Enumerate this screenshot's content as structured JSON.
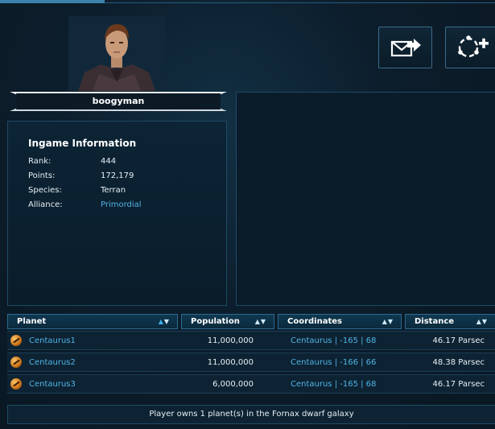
{
  "profile": {
    "player_name": "boogyman",
    "avatar_icon": "commander-portrait"
  },
  "actions": {
    "message_icon": "send-message-icon",
    "friend_icon": "add-buddy-icon"
  },
  "info": {
    "title": "Ingame Information",
    "rows": [
      {
        "label": "Rank:",
        "value": "444"
      },
      {
        "label": "Points:",
        "value": "172,179"
      },
      {
        "label": "Species:",
        "value": "Terran"
      },
      {
        "label": "Alliance:",
        "value": "Primordial"
      }
    ]
  },
  "table": {
    "headers": {
      "planet": "Planet",
      "population": "Population",
      "coordinates": "Coordinates",
      "distance": "Distance"
    },
    "rows": [
      {
        "planet": "Centaurus1",
        "population": "11,000,000",
        "coordinates": "Centaurus | -165 | 68",
        "distance": "46.17 Parsec"
      },
      {
        "planet": "Centaurus2",
        "population": "11,000,000",
        "coordinates": "Centaurus | -166 | 66",
        "distance": "48.38 Parsec"
      },
      {
        "planet": "Centaurus3",
        "population": "6,000,000",
        "coordinates": "Centaurus | -165 | 68",
        "distance": "46.17 Parsec"
      }
    ]
  },
  "footer": {
    "text": "Player owns 1 planet(s) in the Fornax dwarf galaxy"
  },
  "colors": {
    "accent": "#4fb3e6",
    "background": "#0b1a27",
    "border": "#2b6a90"
  }
}
